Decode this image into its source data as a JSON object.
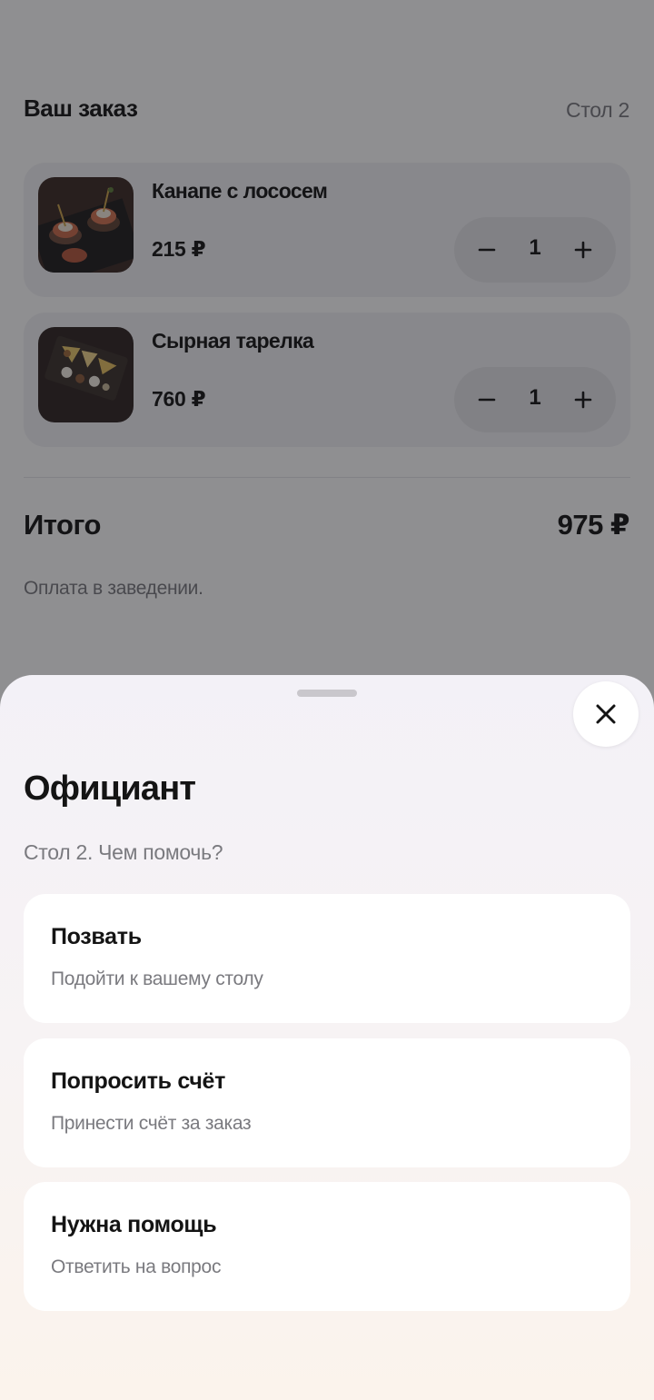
{
  "order": {
    "title": "Ваш заказ",
    "table": "Стол 2",
    "items": [
      {
        "name": "Канапе с лососем",
        "price": "215 ₽",
        "quantity": "1"
      },
      {
        "name": "Сырная тарелка",
        "price": "760 ₽",
        "quantity": "1"
      }
    ],
    "total_label": "Итого",
    "total_value": "975 ₽",
    "payment_note": "Оплата в заведении."
  },
  "waiter_sheet": {
    "title": "Официант",
    "subtitle": "Стол 2. Чем помочь?",
    "options": [
      {
        "title": "Позвать",
        "description": "Подойти к вашему столу"
      },
      {
        "title": "Попросить счёт",
        "description": "Принести счёт за заказ"
      },
      {
        "title": "Нужна помощь",
        "description": "Ответить на вопрос"
      }
    ]
  },
  "icons": {
    "close": "close-icon",
    "minus": "minus-icon",
    "plus": "plus-icon"
  },
  "colors": {
    "text_primary": "#141414",
    "text_secondary": "#7a7a7f",
    "card_background": "#f2f2f5",
    "overlay": "rgba(20,20,26,0.48)"
  }
}
